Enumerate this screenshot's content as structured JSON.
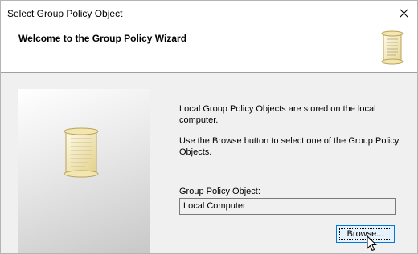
{
  "window": {
    "title": "Select Group Policy Object",
    "close_glyph": "✕"
  },
  "header": {
    "title": "Welcome to the Group Policy Wizard",
    "icon": "scroll-icon"
  },
  "side_panel": {
    "icon": "scroll-icon"
  },
  "body": {
    "description_1": "Local Group Policy Objects are stored on the local computer.",
    "description_2": "Use the Browse button to select one of the Group Policy Objects.",
    "gpo_label": "Group Policy Object:",
    "gpo_value": "Local Computer",
    "browse_label": "Browse..."
  },
  "colors": {
    "focus_border": "#0078d7",
    "button_hover": "#e5f1fb",
    "dialog_bg": "#f0f0f0"
  }
}
